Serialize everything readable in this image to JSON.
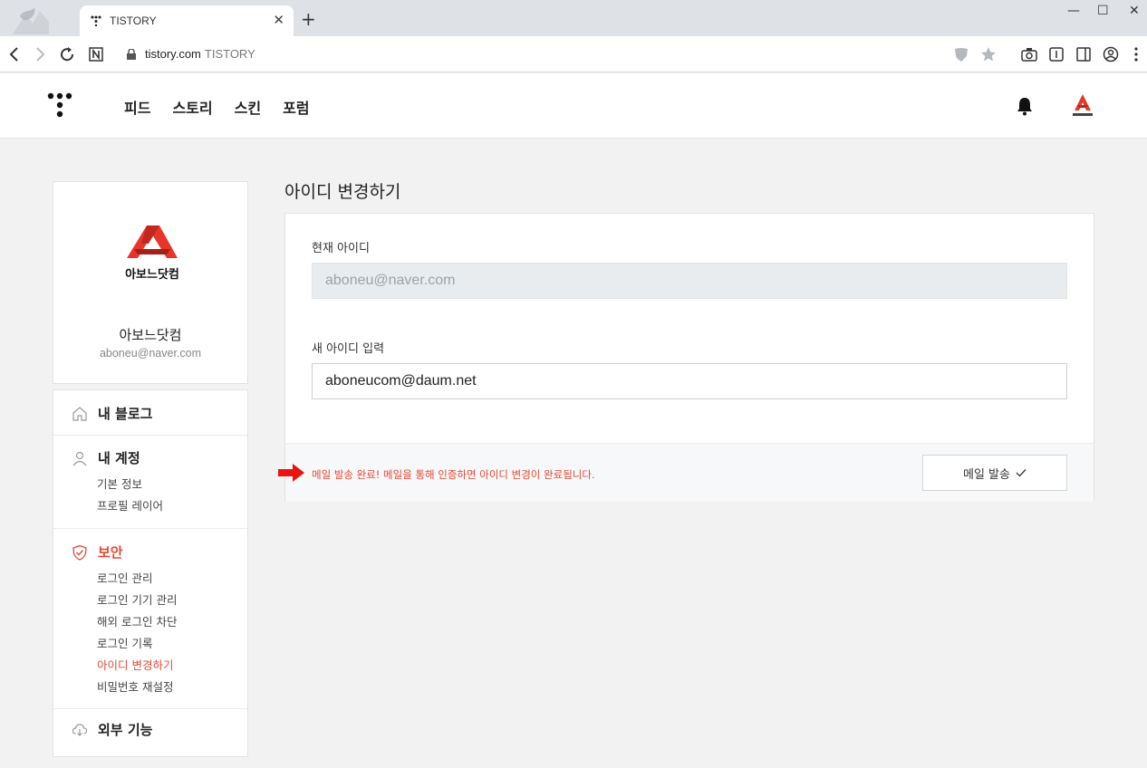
{
  "browser": {
    "tab_title": "TISTORY",
    "tab_close": "✕",
    "new_tab": "+",
    "url_host": "tistory.com",
    "url_site": "TISTORY",
    "window_min": "—",
    "window_max": "☐",
    "window_close": "✕"
  },
  "header": {
    "nav": [
      "피드",
      "스토리",
      "스킨",
      "포럼"
    ]
  },
  "profile": {
    "logo_text": "아보느닷컴",
    "name": "아보느닷컴",
    "email": "aboneu@naver.com"
  },
  "menu": {
    "my_blog": "내 블로그",
    "my_account": "내 계정",
    "account_items": [
      "기본 정보",
      "프로필 레이어"
    ],
    "security": "보안",
    "security_items": [
      "로그인 관리",
      "로그인 기기 관리",
      "해외 로그인 차단",
      "로그인 기록",
      "아이디 변경하기",
      "비밀번호 재설정"
    ],
    "external": "외부 기능"
  },
  "main": {
    "title": "아이디 변경하기",
    "current_label": "현재 아이디",
    "current_value": "aboneu@naver.com",
    "new_label": "새 아이디 입력",
    "new_value": "aboneucom@daum.net",
    "notice": "메일 발송 완료! 메일을 통해 인증하면 아이디 변경이 완료됩니다.",
    "send_button": "메일 발송"
  },
  "colors": {
    "accent": "#e44a37",
    "input_disabled_bg": "#e8ecef"
  }
}
